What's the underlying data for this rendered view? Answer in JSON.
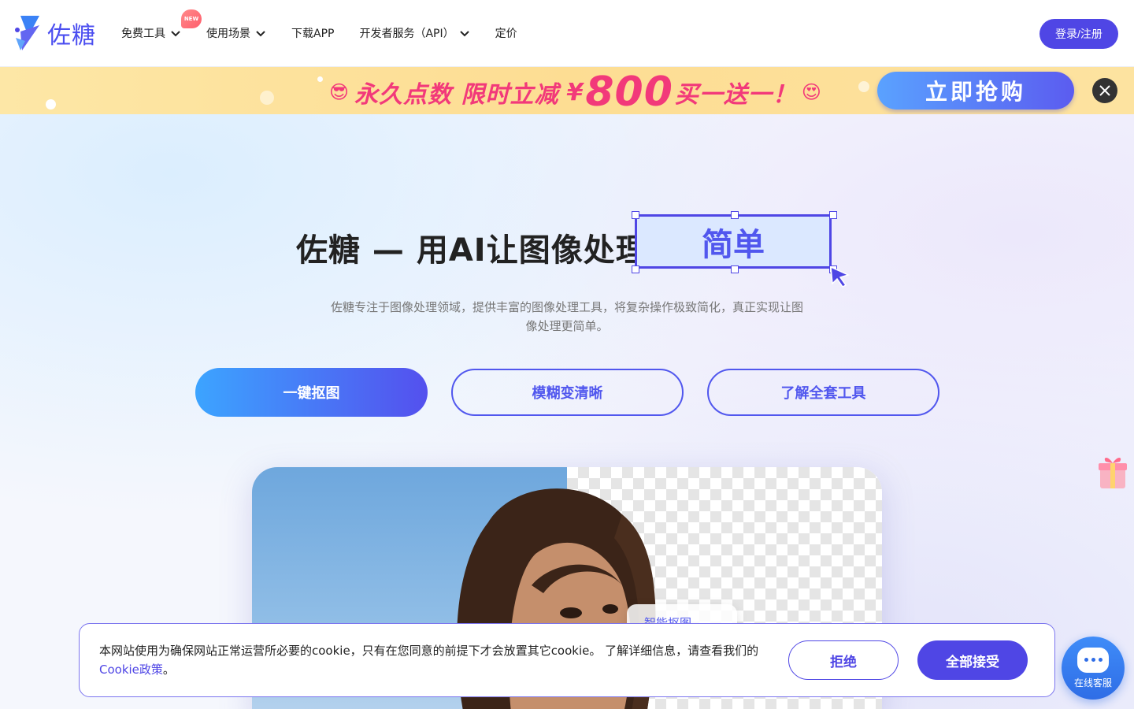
{
  "header": {
    "brand": "佐糖",
    "nav": [
      {
        "label": "免费工具",
        "has_dropdown": true,
        "badge": "NEW"
      },
      {
        "label": "使用场景",
        "has_dropdown": true
      },
      {
        "label": "下载APP",
        "has_dropdown": false
      },
      {
        "label": "开发者服务（API）",
        "has_dropdown": true
      },
      {
        "label": "定价",
        "has_dropdown": false
      }
    ],
    "login_label": "登录/注册"
  },
  "promo": {
    "text_left": "永久点数 限时立减",
    "currency": "¥",
    "amount": "800",
    "text_right": "买一送一！",
    "emoji_left": "😎",
    "emoji_right": "😍",
    "button_label": "立即抢购"
  },
  "hero": {
    "title": "佐糖 — 用AI让图像处理",
    "highlight": "简单",
    "description": "佐糖专注于图像处理领域，提供丰富的图像处理工具，将复杂操作极致简化，真正实现让图像处理更简单。",
    "buttons": [
      "一键抠图",
      "模糊变清晰",
      "了解全套工具"
    ]
  },
  "showcase": {
    "chip_label": "智能抠图"
  },
  "cookie": {
    "text": "本网站使用为确保网站正常运营所必要的cookie，只有在您同意的前提下才会放置其它cookie。 了解详细信息，请查看我们的 ",
    "link": "Cookie政策",
    "suffix": "。",
    "reject_label": "拒绝",
    "accept_label": "全部接受"
  },
  "support": {
    "label": "在线客服"
  },
  "colors": {
    "primary": "#4f46e5",
    "promo_text": "#f2397a",
    "promo_bg": "#fddd93"
  }
}
